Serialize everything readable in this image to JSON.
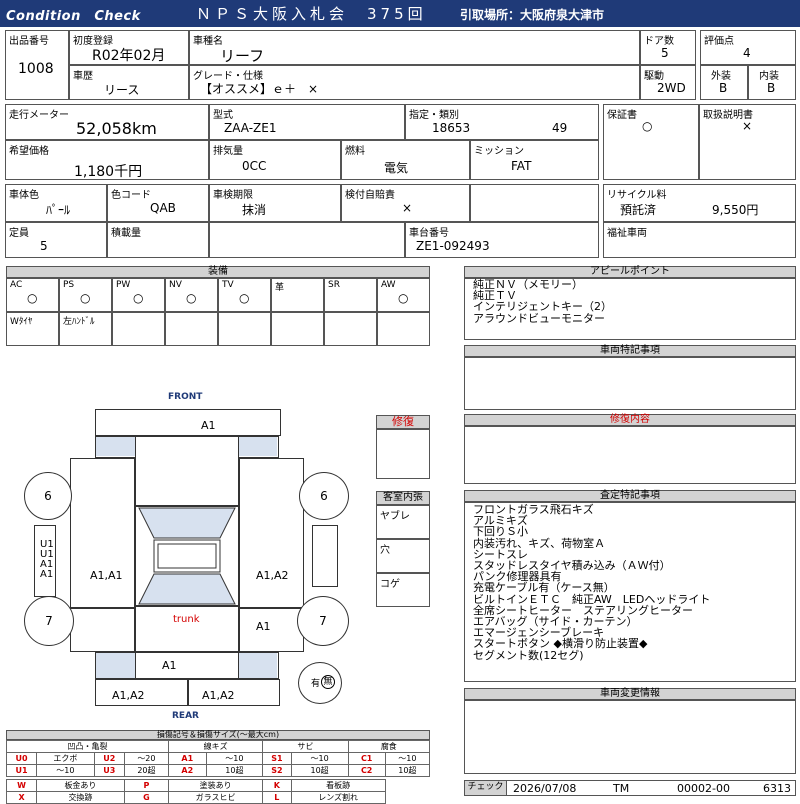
{
  "header": {
    "title": "Condition　Check",
    "auction": "ＮＰＳ大阪入札会　375回",
    "pickup": "引取場所：大阪府泉大津市"
  },
  "car": {
    "lot_label": "出品番号",
    "lot": "1008",
    "reg_label": "初度登録",
    "reg": "R02年02月",
    "name_label": "車種名",
    "name": "リーフ",
    "door_label": "ドア数",
    "door": "5",
    "score_label": "評価点",
    "score": "4",
    "history_label": "車歴",
    "history": "リース",
    "grade_label": "グレード・仕様",
    "grade": "【オススメ】ｅ＋　×",
    "drive_label": "駆動",
    "drive": "2WD",
    "ext_label": "外装",
    "ext": "B",
    "int_label": "内装",
    "int": "B",
    "mileage_label": "走行メーター",
    "mileage": "52,058km",
    "model_label": "型式",
    "model": "ZAA-ZE1",
    "designation_label": "指定・類別",
    "designation": "18653",
    "category": "49",
    "warranty_label": "保証書",
    "warranty": "○",
    "manual_label": "取扱説明書",
    "manual": "×",
    "price_label": "希望価格",
    "price": "1,180千円",
    "cc_label": "排気量",
    "cc": "0CC",
    "fuel_label": "燃料",
    "fuel": "電気",
    "trans_label": "ミッション",
    "trans": "FAT",
    "color_label": "車体色",
    "color": "ﾊﾟｰﾙ",
    "colorcode_label": "色コード",
    "colorcode": "QAB",
    "inspect_label": "車検期限",
    "inspect": "抹消",
    "insurance_label": "検付自賠責",
    "insurance": "×",
    "recycle_label": "リサイクル料",
    "recycle_status": "預託済",
    "recycle_fee": "9,550円",
    "capacity_label": "定員",
    "capacity": "5",
    "load_label": "積載量",
    "load": "",
    "chassis_label": "車台番号",
    "chassis": "ZE1-092493",
    "welfare_label": "福祉車両",
    "welfare": ""
  },
  "equipment": {
    "title": "装備",
    "row1": [
      {
        "k": "AC",
        "v": "○"
      },
      {
        "k": "PS",
        "v": "○"
      },
      {
        "k": "PW",
        "v": "○"
      },
      {
        "k": "NV",
        "v": "○"
      },
      {
        "k": "TV",
        "v": "○"
      },
      {
        "k": "革",
        "v": ""
      },
      {
        "k": "SR",
        "v": ""
      },
      {
        "k": "AW",
        "v": "○"
      }
    ],
    "row2": [
      "Wﾀｲﾔ",
      "左ﾊﾝﾄﾞﾙ",
      "",
      "",
      "",
      "",
      "",
      ""
    ]
  },
  "appeal": {
    "title": "アピールポイント",
    "lines": [
      "純正ＮＶ（メモリー）",
      "純正ＴＶ",
      "インテリジェントキー（2）",
      "アラウンドビューモニター"
    ]
  },
  "special": {
    "title": "車両特記事項"
  },
  "repair": {
    "label": "修復",
    "content_title": "修復内容"
  },
  "interior": {
    "title": "客室内張",
    "yabure": "ヤブレ",
    "ana": "穴",
    "koge": "コゲ"
  },
  "assessment": {
    "title": "査定特記事項",
    "lines": [
      "フロントガラス飛石キズ",
      "アルミキズ",
      "下回りＳ小",
      "内装汚れ、キズ、荷物室Ａ",
      "シートスレ",
      "スタッドレスタイヤ積み込み（ＡＷ付）",
      "パンク修理器具有",
      "充電ケーブル有（ケース無）",
      "ビルトインＥＴＣ　純正AW　LEDヘッドライト",
      "全席シートヒーター　ステアリングヒーター",
      "エアバッグ（サイド・カーテン）",
      "エマージェンシーブレーキ",
      "スタートボタン ◆横滑り防止装置◆",
      "セグメント数(12セグ)"
    ]
  },
  "change": {
    "title": "車両変更情報"
  },
  "diagram": {
    "front": "FRONT",
    "rear": "REAR",
    "trunk": "trunk",
    "wheel_fl": "6",
    "wheel_fr": "6",
    "wheel_rl": "7",
    "wheel_rr": "7",
    "bonnet": "A1",
    "fl_door": "A1,A1",
    "fr_door": "A1,A2",
    "rr_quarter": "A1",
    "rear_panel": "A1",
    "rear_l": "A1,A2",
    "rear_r": "A1,A2",
    "roof_codes": "U1\nU1\nA1\nA1",
    "spare_label": "有",
    "spare_mark": "無"
  },
  "legend": {
    "title": "損傷記号＆損傷サイズ(～最大cm)",
    "cats": [
      "凹凸・亀裂",
      "線キズ",
      "サビ",
      "腐食"
    ],
    "rows": [
      [
        [
          "U0",
          "エクボ"
        ],
        [
          "U2",
          "～20"
        ],
        [
          "A1",
          "～10"
        ],
        [
          "S1",
          "～10"
        ],
        [
          "C1",
          "～10"
        ]
      ],
      [
        [
          "U1",
          "～10"
        ],
        [
          "U3",
          "20超"
        ],
        [
          "A2",
          "10超"
        ],
        [
          "S2",
          "10超"
        ],
        [
          "C2",
          "10超"
        ]
      ]
    ],
    "marks": [
      [
        [
          "W",
          "板金あり"
        ],
        [
          "P",
          "塗装あり"
        ],
        [
          "K",
          "看板跡"
        ]
      ],
      [
        [
          "X",
          "交換跡"
        ],
        [
          "G",
          "ガラスヒビ"
        ],
        [
          "L",
          "レンズ割れ"
        ]
      ]
    ]
  },
  "footer": {
    "check": "チェック",
    "date": "2026/07/08",
    "staff": "TM",
    "code": "00002-00",
    "num": "6313"
  }
}
